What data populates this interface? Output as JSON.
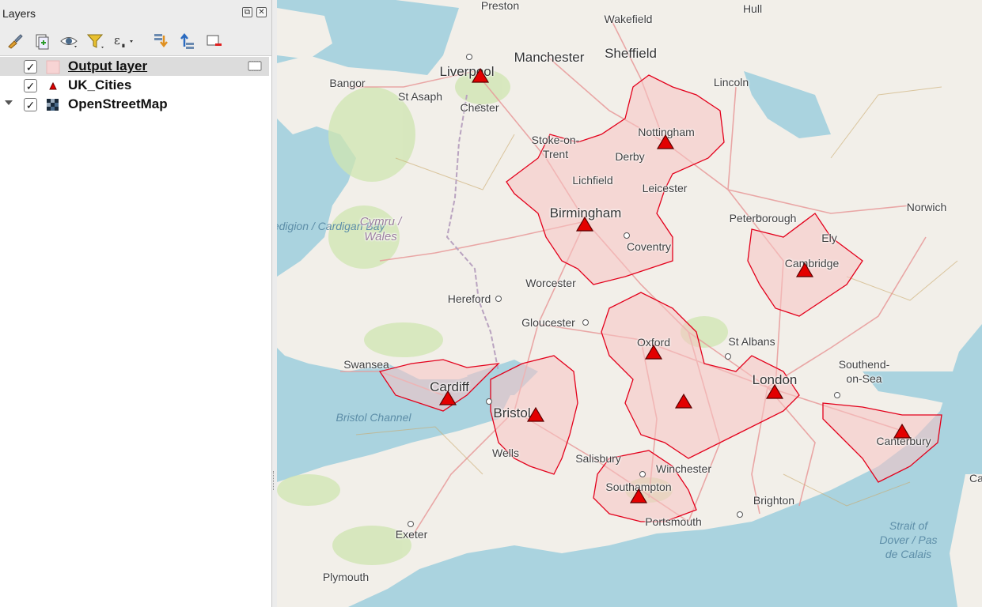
{
  "panel": {
    "title": "Layers",
    "float_button": "⧉",
    "close_button": "✕",
    "toolbar_icons": [
      "style-brush-icon",
      "add-group-icon",
      "visibility-eye-icon",
      "filter-icon",
      "expression-filter-icon",
      "expand-all-icon",
      "collapse-all-icon",
      "remove-layer-icon"
    ]
  },
  "layers": [
    {
      "name": "Output layer",
      "checked": "✓",
      "selected": true,
      "symbol": "polygon-fill",
      "has_indicator": true
    },
    {
      "name": "UK_Cities",
      "checked": "✓",
      "selected": false,
      "symbol": "red-triangle"
    },
    {
      "name": "OpenStreetMap",
      "checked": "✓",
      "selected": false,
      "symbol": "raster-tile",
      "expanded": true
    }
  ],
  "map": {
    "colors": {
      "sea": "#aad3df",
      "land": "#f2efe9",
      "polygon_fill": "#f7c2c2",
      "polygon_stroke": "#e3001b",
      "marker": "#e30000"
    },
    "cities": [
      "Liverpool",
      "Manchester",
      "Sheffield",
      "Birmingham",
      "Cardiff",
      "Bristol",
      "London"
    ],
    "towns": [
      "Preston",
      "Wakefield",
      "Hull",
      "Bangor",
      "St Asaph",
      "Chester",
      "Lincoln",
      "Stoke-on-Trent",
      "Nottingham",
      "Derby",
      "Lichfield",
      "Leicester",
      "Peterborough",
      "Norwich",
      "Coventry",
      "Ely",
      "Cambridge",
      "Worcester",
      "Hereford",
      "Gloucester",
      "Oxford",
      "St Albans",
      "Swansea",
      "Southend-on-Sea",
      "Canterbury",
      "Wells",
      "Salisbury",
      "Winchester",
      "Southampton",
      "Portsmouth",
      "Brighton",
      "Exeter",
      "Plymouth",
      "Ca"
    ],
    "regions": [
      "Cymru / Wales"
    ],
    "water": [
      "Bae Ceredigion / Cardigan Bay",
      "Bristol Channel",
      "Strait of Dover / Pas de Calais"
    ]
  }
}
